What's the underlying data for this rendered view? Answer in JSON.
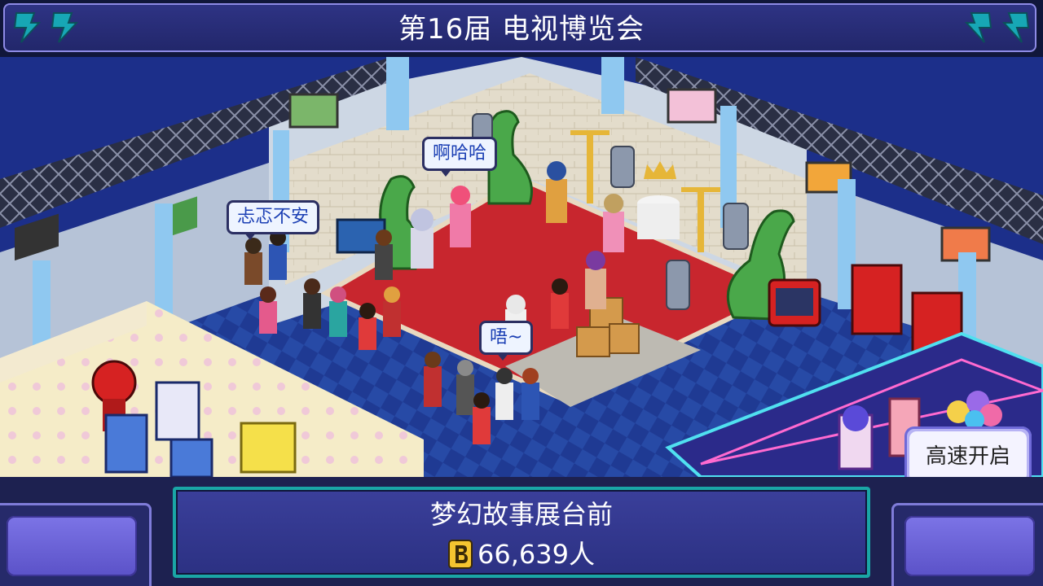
{
  "header": {
    "title": "第16届 电视博览会"
  },
  "scene": {
    "bubbles": [
      {
        "text": "啊哈哈"
      },
      {
        "text": "忐忑不安"
      },
      {
        "text": "唔~"
      }
    ]
  },
  "speed_button": {
    "label": "高速开启"
  },
  "info_panel": {
    "booth_name": "梦幻故事展台前",
    "visitor_count": "66,639人",
    "coin_icon": "b-coin-icon"
  },
  "colors": {
    "title_bg": "#2e3384",
    "accent_border": "#8e8be6",
    "teal_frame": "#1aa6a6",
    "carpet": "#c8262e",
    "floor": "#1f3a93",
    "bolt": "#17a7b5"
  }
}
